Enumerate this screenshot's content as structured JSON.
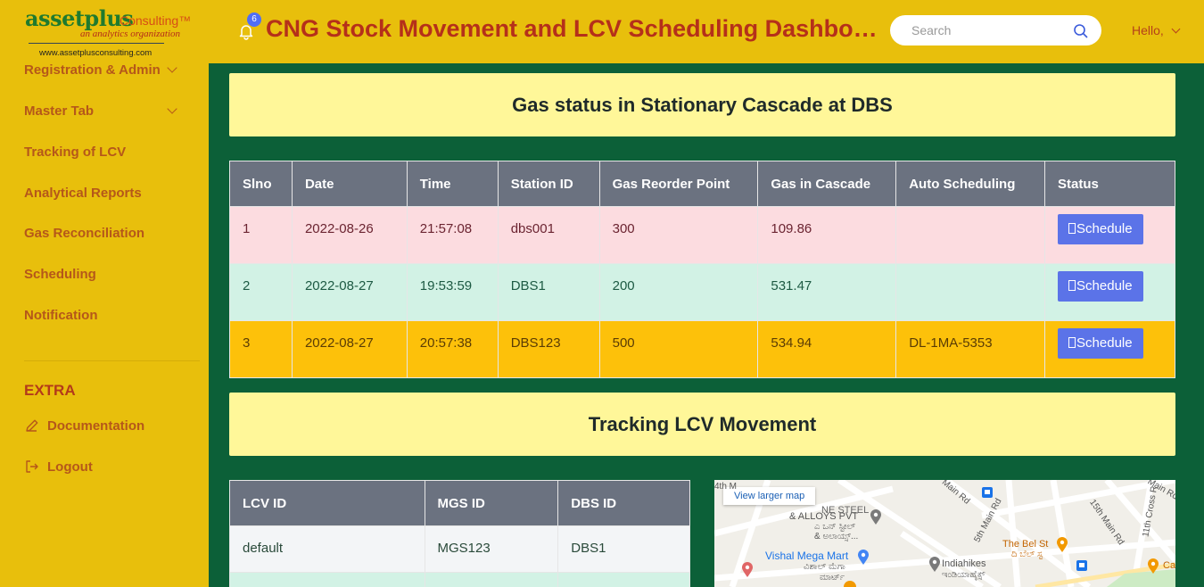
{
  "logo": {
    "brand": "assetplus",
    "brand2": "Consulting™",
    "tagline": "an analytics organization",
    "url": "www.assetplusconsulting.com"
  },
  "sidebar": {
    "items": [
      {
        "label": "Registration & Admin",
        "has_chevron": true
      },
      {
        "label": "Master Tab",
        "has_chevron": true
      },
      {
        "label": "Tracking of LCV",
        "has_chevron": false
      },
      {
        "label": "Analytical Reports",
        "has_chevron": false
      },
      {
        "label": "Gas Reconciliation",
        "has_chevron": false
      },
      {
        "label": "Scheduling",
        "has_chevron": false
      },
      {
        "label": "Notification",
        "has_chevron": false
      }
    ],
    "extra_heading": "EXTRA",
    "extra_items": [
      {
        "label": "Documentation",
        "icon": "pencil-icon"
      },
      {
        "label": "Logout",
        "icon": "logout-icon"
      }
    ]
  },
  "header": {
    "notification_count": "6",
    "title": "CNG Stock Movement and LCV Scheduling Dashboard",
    "search_placeholder": "Search",
    "greeting": "Hello,"
  },
  "cascade": {
    "heading": "Gas status in Stationary Cascade at DBS",
    "columns": [
      "Slno",
      "Date",
      "Time",
      "Station ID",
      "Gas Reorder Point",
      "Gas in Cascade",
      "Auto Scheduling",
      "Status"
    ],
    "rows": [
      {
        "slno": "1",
        "date": "2022-08-26",
        "time": "21:57:08",
        "station": "dbs001",
        "reorder": "300",
        "cascade": "109.86",
        "auto": "",
        "button": "Schedule"
      },
      {
        "slno": "2",
        "date": "2022-08-27",
        "time": "19:53:59",
        "station": "DBS1",
        "reorder": "200",
        "cascade": "531.47",
        "auto": "",
        "button": "Schedule"
      },
      {
        "slno": "3",
        "date": "2022-08-27",
        "time": "20:57:38",
        "station": "DBS123",
        "reorder": "500",
        "cascade": "534.94",
        "auto": "DL-1MA-5353",
        "button": "Schedule"
      }
    ],
    "row_colors": {
      "pink": "#fcdce0",
      "green": "#d2f2e5",
      "amber": "#fdc10a"
    }
  },
  "tracking": {
    "heading": "Tracking LCV Movement",
    "columns": [
      "LCV ID",
      "MGS ID",
      "DBS ID"
    ],
    "rows": [
      {
        "lcv": "default",
        "mgs": "MGS123",
        "dbs": "DBS1"
      },
      {
        "lcv": "",
        "mgs": "",
        "dbs": ""
      }
    ]
  },
  "map": {
    "view_larger": "View larger map",
    "labels": [
      "4th M",
      "NE STEEL",
      "& ALLOYS PVT",
      "ಎ ಒನ್ ಸ್ಟೀಲ್",
      "& ಅಲಾಯ್ಸ್...",
      "Vishal Mega Mart",
      "ವಿಶಾಲ್ ಮೆಗಾ",
      "ಮಾರ್ಟ್",
      "Indiahikes",
      "ಇಂಡಿಯಾಹೈಕ್ಸ್",
      "The Bel St",
      "ದಿ ಬೆಲ್ ಸ್ಟ",
      "Main Rd",
      "5th Main Rd",
      "15th Main Rd",
      "11th Cross R",
      "Ca",
      "Main Rd"
    ]
  },
  "colors": {
    "sidebar_bg": "#e8bf0c",
    "content_bg": "#0c6038",
    "title_color": "#b5301a",
    "banner_bg": "#fff799",
    "table_header": "#6b7280",
    "button": "#5b73e8"
  }
}
